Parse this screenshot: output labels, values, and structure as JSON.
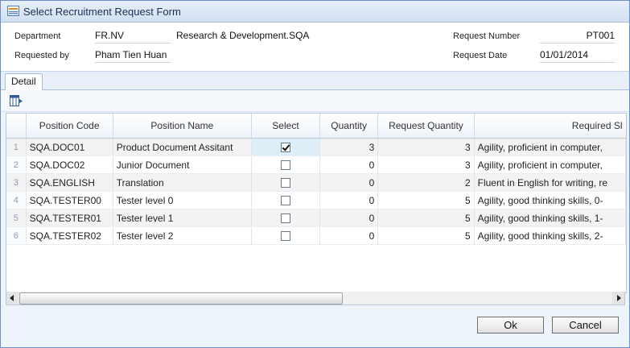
{
  "window": {
    "title": "Select Recruitment Request Form"
  },
  "header": {
    "department_label": "Department",
    "department_code": "FR.NV",
    "department_name": "Research & Development.SQA",
    "requested_by_label": "Requested by",
    "requested_by": "Pham Tien Huan",
    "request_number_label": "Request Number",
    "request_number": "PT001",
    "request_date_label": "Request Date",
    "request_date": "01/01/2014"
  },
  "tabs": [
    {
      "label": "Detail"
    }
  ],
  "grid": {
    "columns": [
      "",
      "Position Code",
      "Position Name",
      "Select",
      "Quantity",
      "Request Quantity",
      "Required Sl"
    ],
    "rows": [
      {
        "n": "1",
        "code": "SQA.DOC01",
        "name": "Product Document Assitant",
        "selected": true,
        "qty": "3",
        "req_qty": "3",
        "skills": "Agility, proficient in computer,"
      },
      {
        "n": "2",
        "code": "SQA.DOC02",
        "name": "Junior Document",
        "selected": false,
        "qty": "0",
        "req_qty": "3",
        "skills": "Agility, proficient in computer,"
      },
      {
        "n": "3",
        "code": "SQA.ENGLISH",
        "name": "Translation",
        "selected": false,
        "qty": "0",
        "req_qty": "2",
        "skills": "Fluent in English for writing, re"
      },
      {
        "n": "4",
        "code": "SQA.TESTER00",
        "name": "Tester level 0",
        "selected": false,
        "qty": "0",
        "req_qty": "5",
        "skills": "Agility, good thinking skills, 0-"
      },
      {
        "n": "5",
        "code": "SQA.TESTER01",
        "name": "Tester level 1",
        "selected": false,
        "qty": "0",
        "req_qty": "5",
        "skills": "Agility, good thinking skills, 1-"
      },
      {
        "n": "6",
        "code": "SQA.TESTER02",
        "name": "Tester level 2",
        "selected": false,
        "qty": "0",
        "req_qty": "5",
        "skills": "Agility, good thinking skills, 2-"
      }
    ]
  },
  "footer": {
    "ok_label": "Ok",
    "cancel_label": "Cancel"
  }
}
